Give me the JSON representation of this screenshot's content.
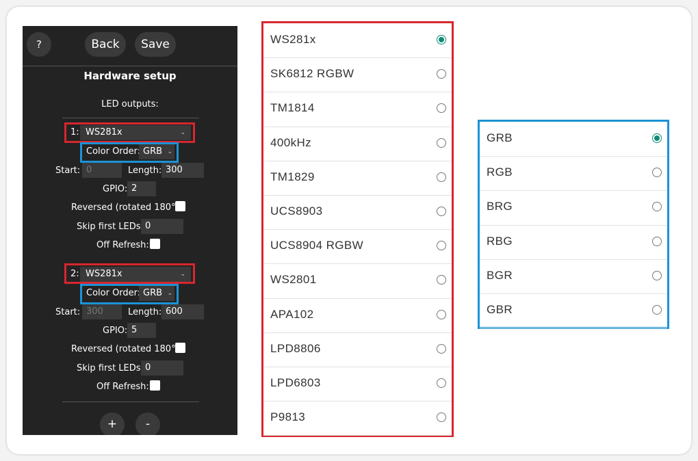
{
  "panel": {
    "help_label": "?",
    "back_label": "Back",
    "save_label": "Save",
    "title": "Hardware setup",
    "led_outputs_label": "LED outputs:",
    "outputs": [
      {
        "index": "1:",
        "type": "WS281x",
        "color_order_label": "Color Order:",
        "color_order": "GRB",
        "start_label": "Start:",
        "start": "0",
        "length_label": "Length:",
        "length": "300",
        "gpio_label": "GPIO:",
        "gpio": "2",
        "reversed_label": "Reversed (rotated 180°):",
        "skip_label": "Skip first LEDs:",
        "skip": "0",
        "off_refresh_label": "Off Refresh:"
      },
      {
        "index": "2:",
        "type": "WS281x",
        "color_order_label": "Color Order:",
        "color_order": "GRB",
        "start_label": "Start:",
        "start": "300",
        "length_label": "Length:",
        "length": "600",
        "gpio_label": "GPIO:",
        "gpio": "5",
        "reversed_label": "Reversed (rotated 180°):",
        "skip_label": "Skip first LEDs:",
        "skip": "0",
        "off_refresh_label": "Off Refresh:"
      }
    ],
    "add_label": "+",
    "remove_label": "-"
  },
  "led_type_list": {
    "selected": "WS281x",
    "options": [
      "WS281x",
      "SK6812 RGBW",
      "TM1814",
      "400kHz",
      "TM1829",
      "UCS8903",
      "UCS8904 RGBW",
      "WS2801",
      "APA102",
      "LPD8806",
      "LPD6803",
      "P9813"
    ]
  },
  "color_order_list": {
    "selected": "GRB",
    "options": [
      "GRB",
      "RGB",
      "BRG",
      "RBG",
      "BGR",
      "GBR"
    ]
  },
  "colors": {
    "highlight_red": "#d8262e",
    "highlight_blue": "#1a93d6",
    "radio_selected": "#0f8a76",
    "panel_bg": "#232323"
  }
}
